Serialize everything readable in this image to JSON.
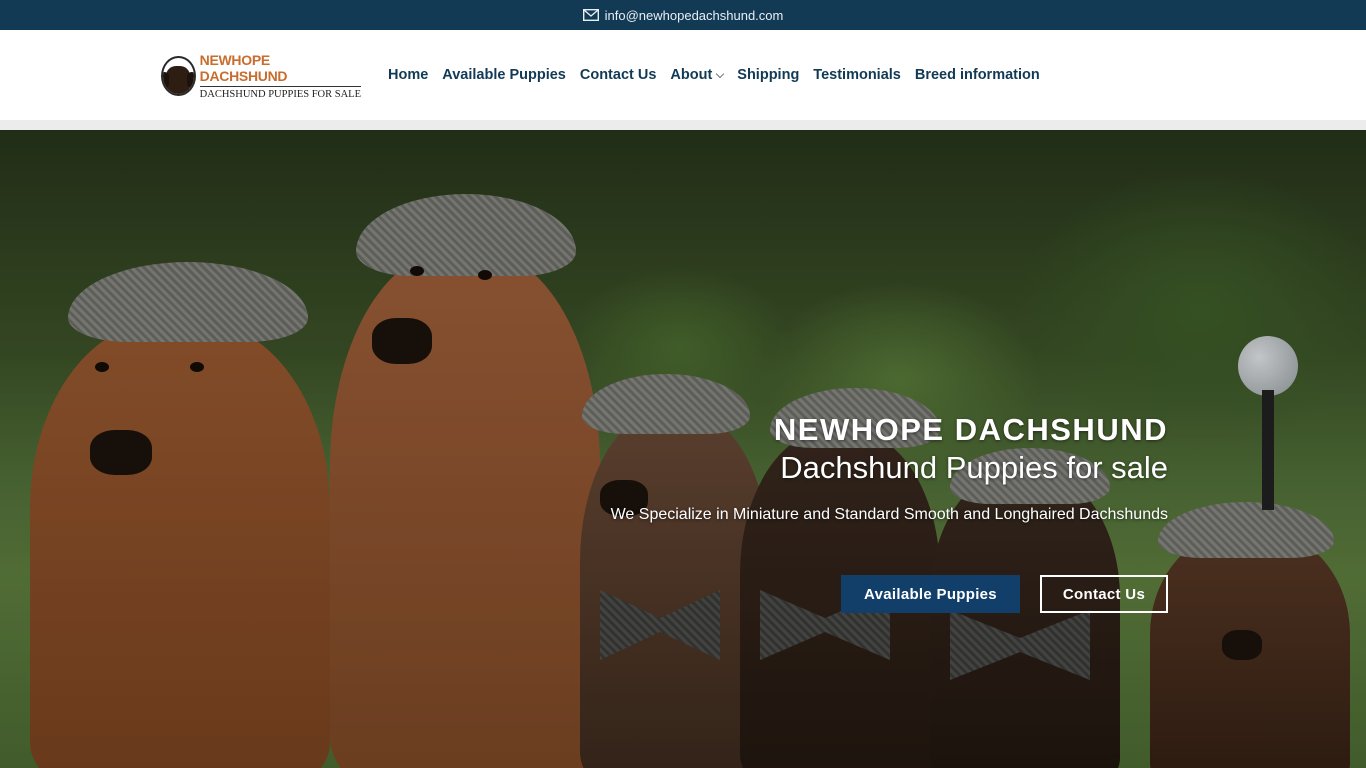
{
  "topbar": {
    "email": "info@newhopedachshund.com",
    "icon": "mail-icon"
  },
  "logo": {
    "brand": "NEWHOPE DACHSHUND",
    "tagline": "DACHSHUND PUPPIES FOR SALE"
  },
  "nav": {
    "items": [
      {
        "label": "Home"
      },
      {
        "label": "Available Puppies"
      },
      {
        "label": "Contact Us"
      },
      {
        "label": "About",
        "has_dropdown": true
      },
      {
        "label": "Shipping"
      },
      {
        "label": "Testimonials"
      },
      {
        "label": "Breed information"
      }
    ]
  },
  "hero": {
    "title": "NEWHOPE DACHSHUND",
    "subtitle": "Dachshund Puppies for sale",
    "description": "We Specialize in Miniature and Standard Smooth and Longhaired Dachshunds",
    "primary_button": "Available Puppies",
    "secondary_button": "Contact Us"
  },
  "colors": {
    "brand_navy": "#123a55",
    "button_blue": "#123f6a",
    "logo_orange": "#c86d2e"
  }
}
